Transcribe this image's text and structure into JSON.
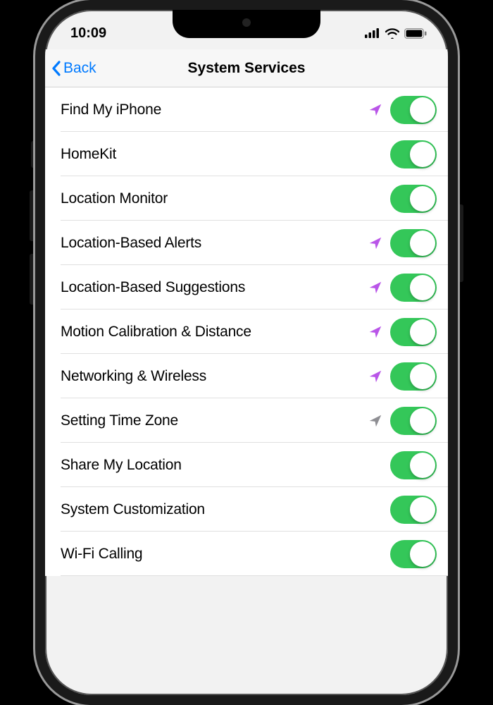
{
  "statusbar": {
    "time": "10:09"
  },
  "nav": {
    "back_label": "Back",
    "title": "System Services"
  },
  "colors": {
    "accent_blue": "#007aff",
    "toggle_green": "#34c759",
    "arrow_purple": "#b955e8",
    "arrow_gray": "#8e8e93"
  },
  "rows": [
    {
      "label": "Find My iPhone",
      "arrow": "purple",
      "toggle": true
    },
    {
      "label": "HomeKit",
      "arrow": null,
      "toggle": true
    },
    {
      "label": "Location Monitor",
      "arrow": null,
      "toggle": true
    },
    {
      "label": "Location-Based Alerts",
      "arrow": "purple",
      "toggle": true
    },
    {
      "label": "Location-Based Suggestions",
      "arrow": "purple",
      "toggle": true
    },
    {
      "label": "Motion Calibration & Distance",
      "arrow": "purple",
      "toggle": true
    },
    {
      "label": "Networking & Wireless",
      "arrow": "purple",
      "toggle": true
    },
    {
      "label": "Setting Time Zone",
      "arrow": "gray",
      "toggle": true
    },
    {
      "label": "Share My Location",
      "arrow": null,
      "toggle": true
    },
    {
      "label": "System Customization",
      "arrow": null,
      "toggle": true
    },
    {
      "label": "Wi-Fi Calling",
      "arrow": null,
      "toggle": true
    }
  ]
}
